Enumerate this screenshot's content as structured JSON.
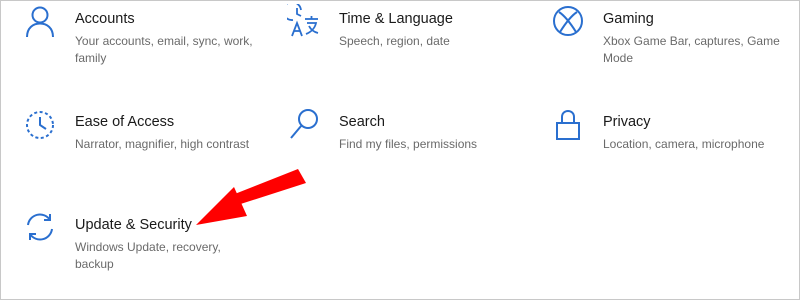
{
  "accent_color": "#2a6fcf",
  "arrow_color": "#ff0000",
  "tiles": [
    {
      "title": "Accounts",
      "desc": "Your accounts, email, sync, work, family",
      "icon": "person-icon"
    },
    {
      "title": "Time & Language",
      "desc": "Speech, region, date",
      "icon": "time-language-icon"
    },
    {
      "title": "Gaming",
      "desc": "Xbox Game Bar, captures, Game Mode",
      "icon": "xbox-icon"
    },
    {
      "title": "Ease of Access",
      "desc": "Narrator, magnifier, high contrast",
      "icon": "ease-of-access-icon"
    },
    {
      "title": "Search",
      "desc": "Find my files, permissions",
      "icon": "search-icon"
    },
    {
      "title": "Privacy",
      "desc": "Location, camera, microphone",
      "icon": "lock-icon"
    },
    {
      "title": "Update & Security",
      "desc": "Windows Update, recovery, backup",
      "icon": "sync-icon"
    }
  ]
}
